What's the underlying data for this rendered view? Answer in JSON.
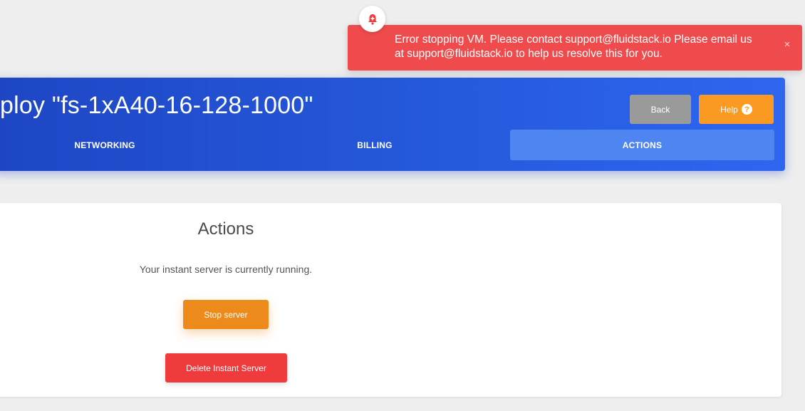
{
  "header": {
    "title": "ploy \"fs-1xA40-16-128-1000\"",
    "back_label": "Back",
    "help_label": "Help",
    "help_icon_glyph": "?"
  },
  "tabs": [
    {
      "label": "NETWORKING",
      "active": false
    },
    {
      "label": "BILLING",
      "active": false
    },
    {
      "label": "ACTIONS",
      "active": true
    }
  ],
  "actions": {
    "title": "Actions",
    "status": "Your instant server is currently running.",
    "stop_label": "Stop server",
    "delete_label": "Delete Instant Server"
  },
  "toast": {
    "message": "Error stopping VM. Please contact support@fluidstack.io Please email us at support@fluidstack.io to help us resolve this for you.",
    "close_glyph": "×",
    "icon": "bell-icon"
  },
  "colors": {
    "header_gradient_start": "#1e46c4",
    "header_gradient_end": "#2e66f0",
    "active_tab": "#4f85f0",
    "back_button": "#9a9a9a",
    "help_button": "#fb9a22",
    "stop_button": "#ec8b1c",
    "delete_button": "#ef3b3c",
    "toast_bg": "#f04b4c"
  }
}
